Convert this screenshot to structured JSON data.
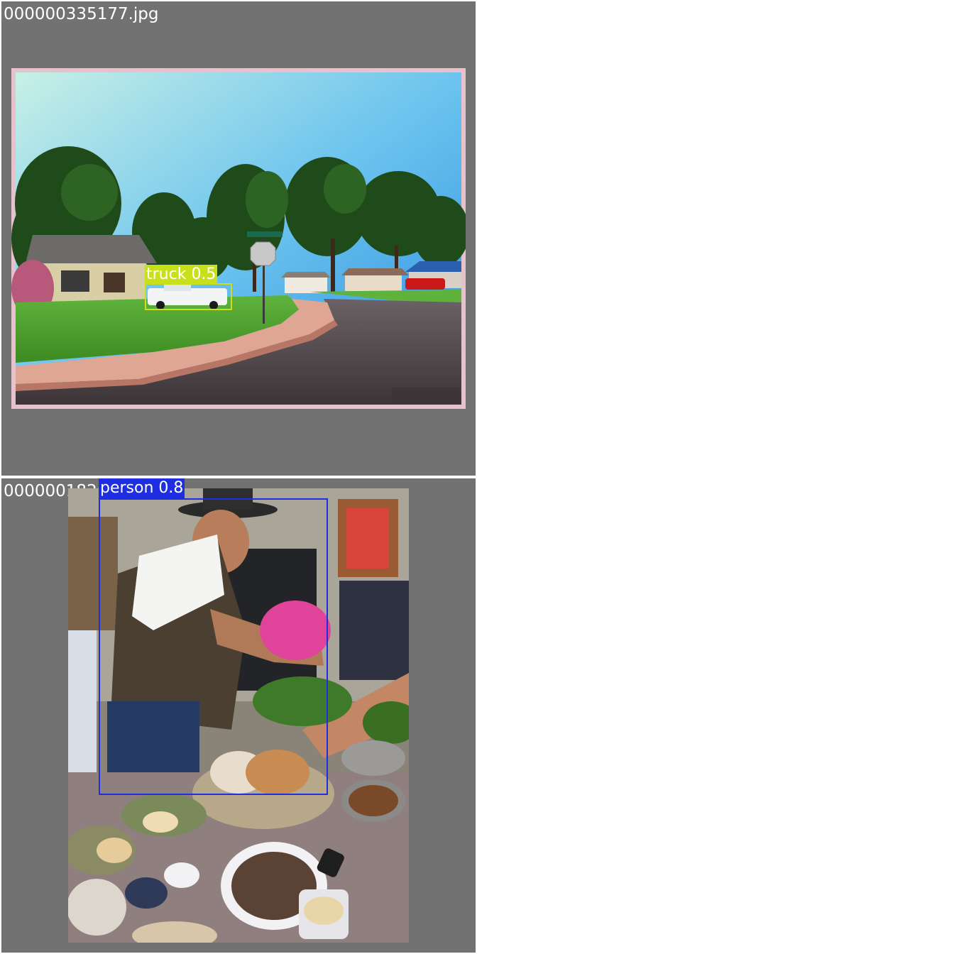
{
  "tiles": [
    {
      "filename": "000000335177.jpg",
      "detections": [
        {
          "label": "truck 0.5",
          "color": "#c8e01c"
        }
      ]
    },
    {
      "filename": "000000182611.jpg",
      "detections": [
        {
          "label": "person 0.8",
          "color": "#1e2ee0"
        }
      ]
    }
  ],
  "colors": {
    "tile_background": "#727272",
    "page_background": "#ffffff"
  }
}
